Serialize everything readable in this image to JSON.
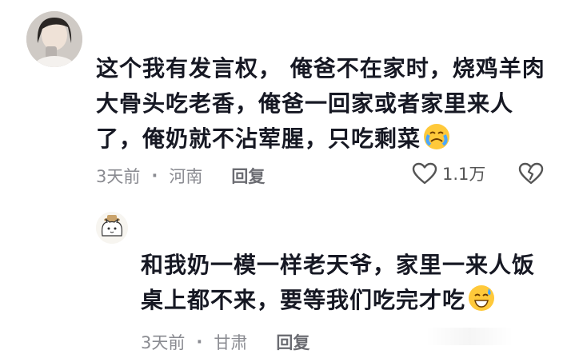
{
  "comment": {
    "text": "这个我有发言权， 俺爸不在家时，烧鸡羊肉大骨头吃老香，俺爸一回家或者家里来人了，俺奶就不沾荤腥，只吃剩菜",
    "emoji": "crying-face-emoji",
    "time": "3天前",
    "location": "河南",
    "reply_label": "回复",
    "like_count": "1.1万"
  },
  "reply": {
    "text": "和我奶一模一样老天爷，家里一来人饭桌上都不来，要等我们吃完才吃",
    "emoji": "sweat-smile-emoji",
    "time": "3天前",
    "location": "甘肃",
    "reply_label": "回复"
  },
  "separator": "·",
  "icons": {
    "like": "heart-outline-icon",
    "dislike": "broken-heart-icon"
  }
}
